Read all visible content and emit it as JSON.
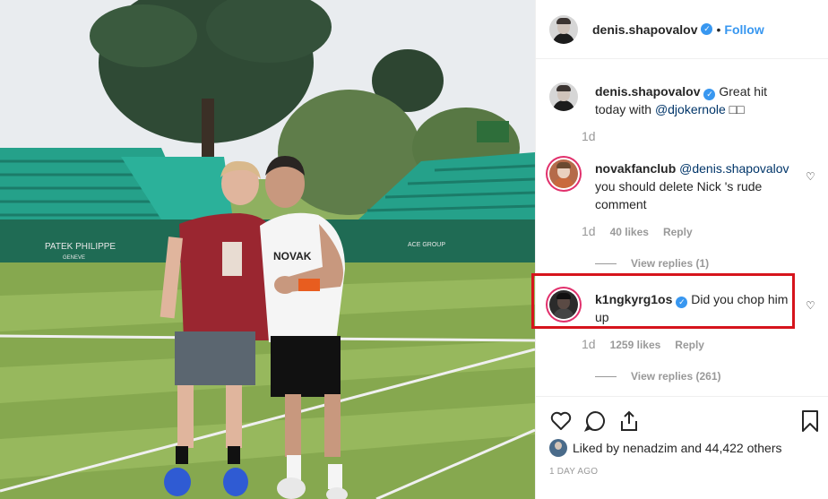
{
  "post": {
    "author": "denis.shapovalov",
    "follow_label": "Follow",
    "dot": "•",
    "photo": {
      "banner_left": "PATEK PHILIPPE",
      "banner_left_sub": "GENEVE",
      "banner_right": "ACE GROUP",
      "shirt_text": "NOVAK"
    }
  },
  "caption": {
    "user": "denis.shapovalov",
    "text": "Great hit today with",
    "mention": "@djokernole",
    "emoji": "□□",
    "time": "1d"
  },
  "comments": [
    {
      "user": "novakfanclub",
      "mention": "@denis.shapovalov",
      "text": "you should delete Nick 's rude comment",
      "time": "1d",
      "likes": "40 likes",
      "reply": "Reply",
      "view_replies": "View replies (1)"
    },
    {
      "user": "k1ngkyrg1os",
      "text": "Did you chop him up",
      "time": "1d",
      "likes": "1259 likes",
      "reply": "Reply",
      "view_replies": "View replies (261)"
    }
  ],
  "likes": {
    "prefix": "Liked by",
    "user": "nenadzim",
    "suffix": "and 44,422 others"
  },
  "age": "1 DAY AGO",
  "colors": {
    "accent": "#3897f0",
    "highlight": "#d6141c",
    "muted": "#999999"
  },
  "icons": [
    "heart-icon",
    "comment-icon",
    "share-icon",
    "bookmark-icon",
    "verified-icon"
  ]
}
